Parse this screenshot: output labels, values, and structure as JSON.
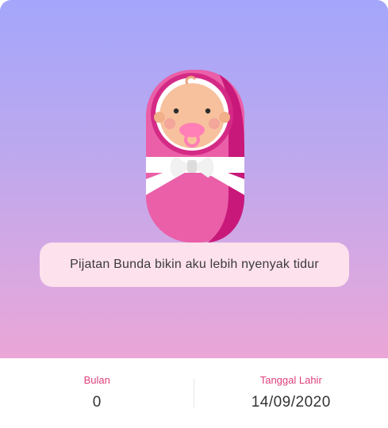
{
  "message": "Pijatan Bunda bikin aku lebih nyenyak tidur",
  "illustration_icon": "swaddled-baby-icon",
  "stats": {
    "month_label": "Bulan",
    "month_value": "0",
    "birthdate_label": "Tanggal Lahir",
    "birthdate_value": "14/09/2020"
  },
  "colors": {
    "gradient_top": "#a4a6fb",
    "gradient_bottom": "#eaa6d6",
    "accent": "#e0407b",
    "message_bg": "#fde1ec"
  }
}
